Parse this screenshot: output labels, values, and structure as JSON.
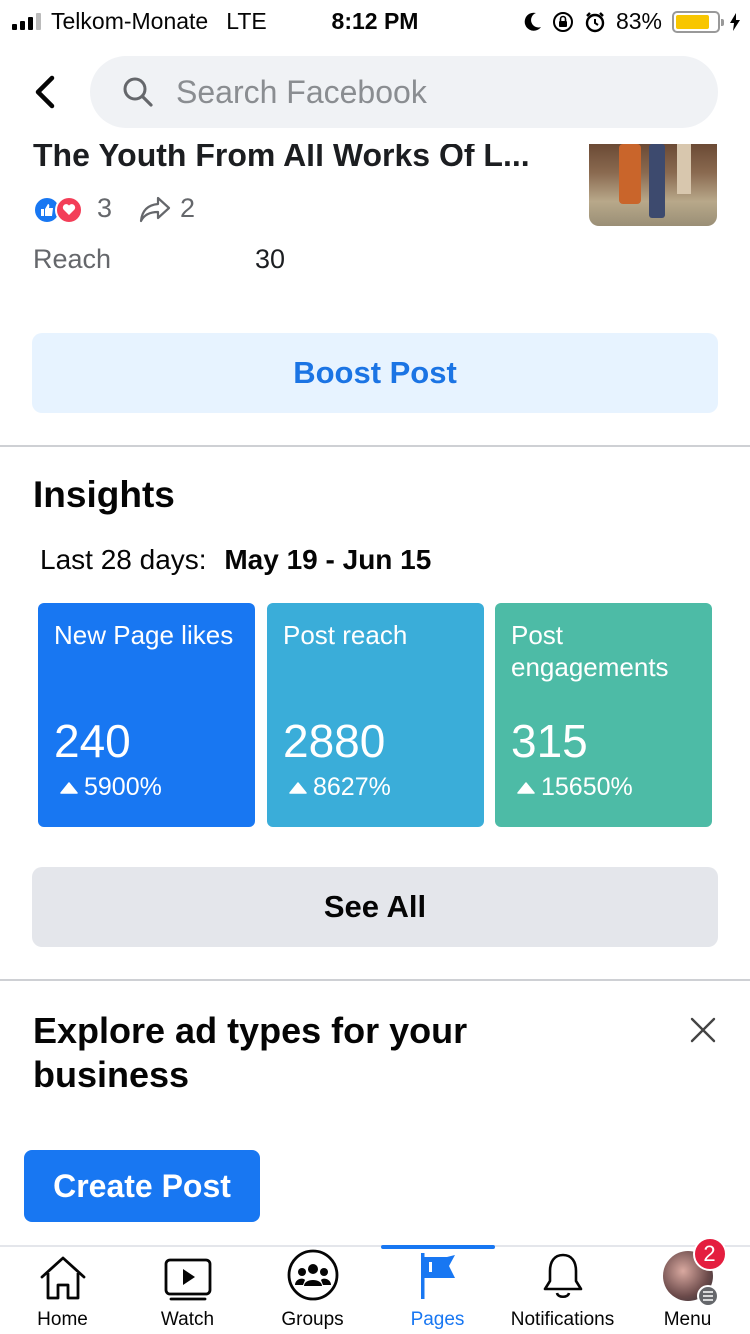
{
  "status_bar": {
    "carrier": "Telkom-Monate",
    "network": "LTE",
    "time": "8:12 PM",
    "battery_percent": "83%",
    "battery_level": 0.83,
    "icons": [
      "signal-icon",
      "moon-icon",
      "rotation-lock-icon",
      "alarm-icon",
      "battery-icon",
      "charging-icon"
    ]
  },
  "header": {
    "search_placeholder": "Search Facebook"
  },
  "post": {
    "title": "The Youth From All Works Of L...",
    "reaction_count": "3",
    "share_count": "2",
    "reach_label": "Reach",
    "reach_value": "30"
  },
  "boost": {
    "label": "Boost Post"
  },
  "insights": {
    "title": "Insights",
    "range_label": "Last 28 days:",
    "range_value": "May 19 - Jun 15",
    "tiles": [
      {
        "label": "New Page likes",
        "value": "240",
        "change": "5900%",
        "color": "#1877f2"
      },
      {
        "label": "Post reach",
        "value": "2880",
        "change": "8627%",
        "color": "#3aadd9"
      },
      {
        "label": "Post engagements",
        "value": "315",
        "change": "15650%",
        "color": "#4dbba6"
      }
    ],
    "see_all_label": "See All"
  },
  "explore": {
    "title": "Explore ad types for your business",
    "create_post_label": "Create Post"
  },
  "tab_bar": {
    "active": "Pages",
    "items": [
      {
        "label": "Home",
        "icon": "home-icon"
      },
      {
        "label": "Watch",
        "icon": "watch-icon"
      },
      {
        "label": "Groups",
        "icon": "groups-icon"
      },
      {
        "label": "Pages",
        "icon": "flag-icon"
      },
      {
        "label": "Notifications",
        "icon": "bell-icon"
      },
      {
        "label": "Menu",
        "icon": "avatar"
      }
    ],
    "menu_badge": "2"
  },
  "colors": {
    "accent": "#1877f2",
    "boost_bg": "#e7f3ff",
    "see_all_bg": "#e4e6eb"
  }
}
